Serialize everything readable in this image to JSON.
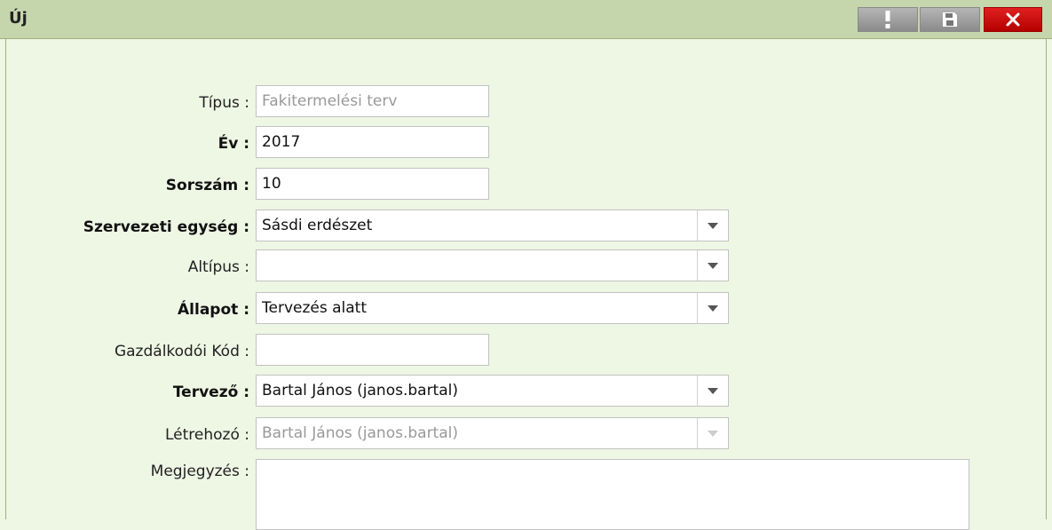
{
  "window": {
    "title": "Új"
  },
  "form": {
    "tipus": {
      "label": "Típus :",
      "value": "Fakitermelési terv"
    },
    "ev": {
      "label": "Év :",
      "value": "2017"
    },
    "sorszam": {
      "label": "Sorszám :",
      "value": "10"
    },
    "szervezeti_egyseg": {
      "label": "Szervezeti egység :",
      "value": "Sásdi erdészet"
    },
    "altipus": {
      "label": "Altípus :",
      "value": ""
    },
    "allapot": {
      "label": "Állapot :",
      "value": "Tervezés alatt"
    },
    "gazdalkodoi_kod": {
      "label": "Gazdálkodói Kód :",
      "value": ""
    },
    "tervezo": {
      "label": "Tervező :",
      "value": "Bartal János (janos.bartal)"
    },
    "letrehozo": {
      "label": "Létrehozó :",
      "value": "Bartal János (janos.bartal)"
    },
    "megjegyzes": {
      "label": "Megjegyzés :",
      "value": ""
    }
  },
  "colors": {
    "titlebar": "#c6d6ac",
    "background": "#eef6e4",
    "close": "#d00000"
  }
}
